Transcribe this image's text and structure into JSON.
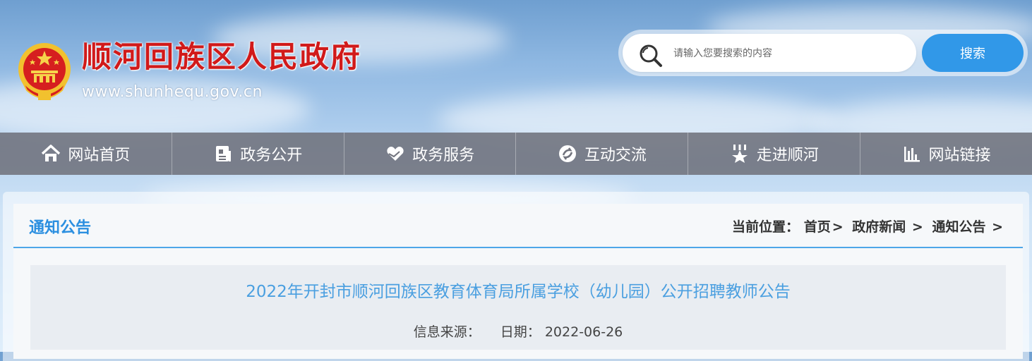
{
  "header": {
    "site_name": "顺河回族区人民政府",
    "site_url": "www.shunhequ.gov.cn",
    "emblem_icon": "national-emblem-icon"
  },
  "search": {
    "placeholder": "请输入您要搜索的内容",
    "value": "",
    "button_label": "搜索",
    "button_color": "#3198e8"
  },
  "nav": {
    "items": [
      {
        "label": "网站首页",
        "icon": "home-icon"
      },
      {
        "label": "政务公开",
        "icon": "document-icon"
      },
      {
        "label": "政务服务",
        "icon": "heart-hands-icon"
      },
      {
        "label": "互动交流",
        "icon": "chat-icon"
      },
      {
        "label": "走进顺河",
        "icon": "star-trophy-icon"
      },
      {
        "label": "网站链接",
        "icon": "bar-chart-icon"
      }
    ]
  },
  "section": {
    "title": "通知公告",
    "accent_color": "#2b8fe0"
  },
  "breadcrumb": {
    "label": "当前位置：",
    "items": [
      "首页",
      "政府新闻",
      "通知公告"
    ]
  },
  "article": {
    "title": "2022年开封市顺河回族区教育体育局所属学校（幼儿园）公开招聘教师公告",
    "source_label": "信息来源：",
    "source_value": "",
    "date_label": "日期：",
    "date_value": "2022-06-26"
  }
}
